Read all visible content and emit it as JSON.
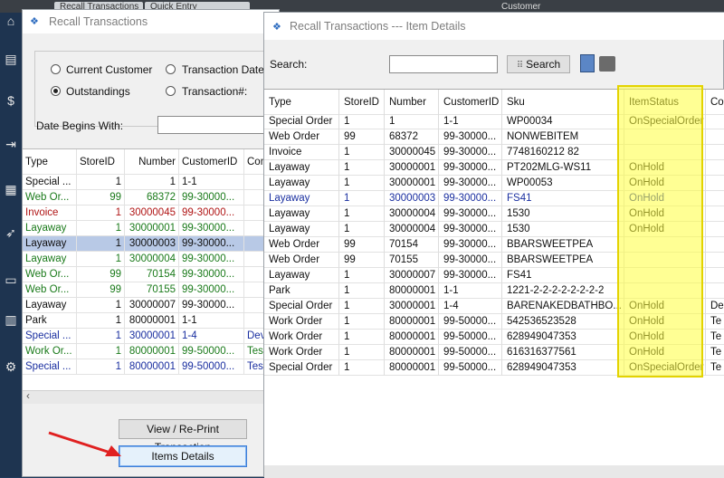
{
  "background_app": {
    "tabs": [
      "Recall Transactions",
      "Quick Entry",
      "Customer"
    ],
    "side_icons": [
      "home-icon",
      "register-icon",
      "dollar-icon",
      "exit-icon",
      "grid-icon",
      "rocket-icon",
      "chat-icon",
      "document-icon",
      "gear-icon"
    ]
  },
  "recall_window": {
    "title": "Recall Transactions",
    "options": [
      {
        "label": "Current Customer",
        "checked": false
      },
      {
        "label": "Transaction Date:",
        "checked": false
      },
      {
        "label": "Outstandings",
        "checked": true
      },
      {
        "label": "Transaction#:",
        "checked": false
      }
    ],
    "date_begins_label": "Date Begins With:",
    "date_begins_value": "",
    "columns": [
      "Type",
      "StoreID",
      "Number",
      "CustomerID",
      "Con"
    ],
    "rows": [
      {
        "type": "Special ...",
        "store": "1",
        "number": "1",
        "customer": "1-1",
        "con": "",
        "color": "#111111",
        "selected": false
      },
      {
        "type": "Web Or...",
        "store": "99",
        "number": "68372",
        "customer": "99-30000...",
        "con": "",
        "color": "#1a7a1a",
        "selected": false
      },
      {
        "type": "Invoice",
        "store": "1",
        "number": "30000045",
        "customer": "99-30000...",
        "con": "",
        "color": "#b01515",
        "selected": false
      },
      {
        "type": "Layaway",
        "store": "1",
        "number": "30000001",
        "customer": "99-30000...",
        "con": "",
        "color": "#1a7a1a",
        "selected": false
      },
      {
        "type": "Layaway",
        "store": "1",
        "number": "30000003",
        "customer": "99-30000...",
        "con": "",
        "color": "#111111",
        "selected": true
      },
      {
        "type": "Layaway",
        "store": "1",
        "number": "30000004",
        "customer": "99-30000...",
        "con": "",
        "color": "#1a7a1a",
        "selected": false
      },
      {
        "type": "Web Or...",
        "store": "99",
        "number": "70154",
        "customer": "99-30000...",
        "con": "",
        "color": "#1a7a1a",
        "selected": false
      },
      {
        "type": "Web Or...",
        "store": "99",
        "number": "70155",
        "customer": "99-30000...",
        "con": "",
        "color": "#1a7a1a",
        "selected": false
      },
      {
        "type": "Layaway",
        "store": "1",
        "number": "30000007",
        "customer": "99-30000...",
        "con": "",
        "color": "#111111",
        "selected": false
      },
      {
        "type": "Park",
        "store": "1",
        "number": "80000001",
        "customer": "1-1",
        "con": "",
        "color": "#111111",
        "selected": false
      },
      {
        "type": "Special ...",
        "store": "1",
        "number": "30000001",
        "customer": "1-4",
        "con": "Dev",
        "color": "#1a2fa0",
        "selected": false
      },
      {
        "type": "Work Or...",
        "store": "1",
        "number": "80000001",
        "customer": "99-50000...",
        "con": "Tes",
        "color": "#1a7a1a",
        "selected": false
      },
      {
        "type": "Special ...",
        "store": "1",
        "number": "80000001",
        "customer": "99-50000...",
        "con": "Tes",
        "color": "#1a2fa0",
        "selected": false
      }
    ],
    "view_button": "View / Re-Print Transaction",
    "items_button": "Items Details"
  },
  "items_window": {
    "title": "Recall Transactions --- Item Details",
    "search_label": "Search:",
    "search_value": "",
    "search_button": "Search",
    "columns": [
      "Type",
      "StoreID",
      "Number",
      "CustomerID",
      "Sku",
      "ItemStatus",
      "Co"
    ],
    "rows": [
      {
        "type": "Special Order",
        "store": "1",
        "number": "1",
        "customer": "1-1",
        "sku": "WP00034",
        "status": "OnSpecialOrder",
        "co": "",
        "color": "#111111"
      },
      {
        "type": "Web Order",
        "store": "99",
        "number": "68372",
        "customer": "99-30000...",
        "sku": "NONWEBITEM",
        "status": "",
        "co": "",
        "color": "#111111"
      },
      {
        "type": "Invoice",
        "store": "1",
        "number": "30000045",
        "customer": "99-30000...",
        "sku": "7748160212 82",
        "status": "",
        "co": "",
        "color": "#111111"
      },
      {
        "type": "Layaway",
        "store": "1",
        "number": "30000001",
        "customer": "99-30000...",
        "sku": "PT202MLG-WS11",
        "status": "OnHold",
        "co": "",
        "color": "#111111"
      },
      {
        "type": "Layaway",
        "store": "1",
        "number": "30000001",
        "customer": "99-30000...",
        "sku": "WP00053",
        "status": "OnHold",
        "co": "",
        "color": "#111111"
      },
      {
        "type": "Layaway",
        "store": "1",
        "number": "30000003",
        "customer": "99-30000...",
        "sku": "FS41",
        "status": "OnHold",
        "co": "",
        "color": "#1a2fa0"
      },
      {
        "type": "Layaway",
        "store": "1",
        "number": "30000004",
        "customer": "99-30000...",
        "sku": "1530",
        "status": "OnHold",
        "co": "",
        "color": "#111111"
      },
      {
        "type": "Layaway",
        "store": "1",
        "number": "30000004",
        "customer": "99-30000...",
        "sku": "1530",
        "status": "OnHold",
        "co": "",
        "color": "#111111"
      },
      {
        "type": "Web Order",
        "store": "99",
        "number": "70154",
        "customer": "99-30000...",
        "sku": "BBARSWEETPEA",
        "status": "",
        "co": "",
        "color": "#111111"
      },
      {
        "type": "Web Order",
        "store": "99",
        "number": "70155",
        "customer": "99-30000...",
        "sku": "BBARSWEETPEA",
        "status": "",
        "co": "",
        "color": "#111111"
      },
      {
        "type": "Layaway",
        "store": "1",
        "number": "30000007",
        "customer": "99-30000...",
        "sku": "FS41",
        "status": "",
        "co": "",
        "color": "#111111"
      },
      {
        "type": "Park",
        "store": "1",
        "number": "80000001",
        "customer": "1-1",
        "sku": "1221-2-2-2-2-2-2-2-2",
        "status": "",
        "co": "",
        "color": "#111111"
      },
      {
        "type": "Special Order",
        "store": "1",
        "number": "30000001",
        "customer": "1-4",
        "sku": "BARENAKEDBATHBO...",
        "status": "OnHold",
        "co": "De",
        "color": "#111111"
      },
      {
        "type": "Work Order",
        "store": "1",
        "number": "80000001",
        "customer": "99-50000...",
        "sku": "542536523528",
        "status": "OnHold",
        "co": "Te",
        "color": "#111111"
      },
      {
        "type": "Work Order",
        "store": "1",
        "number": "80000001",
        "customer": "99-50000...",
        "sku": "628949047353",
        "status": "OnHold",
        "co": "Te",
        "color": "#111111"
      },
      {
        "type": "Work Order",
        "store": "1",
        "number": "80000001",
        "customer": "99-50000...",
        "sku": "616316377561",
        "status": "OnHold",
        "co": "Te",
        "color": "#111111"
      },
      {
        "type": "Special Order",
        "store": "1",
        "number": "80000001",
        "customer": "99-50000...",
        "sku": "628949047353",
        "status": "OnSpecialOrder",
        "co": "Te",
        "color": "#111111"
      }
    ]
  },
  "colors": {
    "highlight": "#ffff3c",
    "arrow": "#e02020",
    "selected_row": "#b8c9e6"
  }
}
